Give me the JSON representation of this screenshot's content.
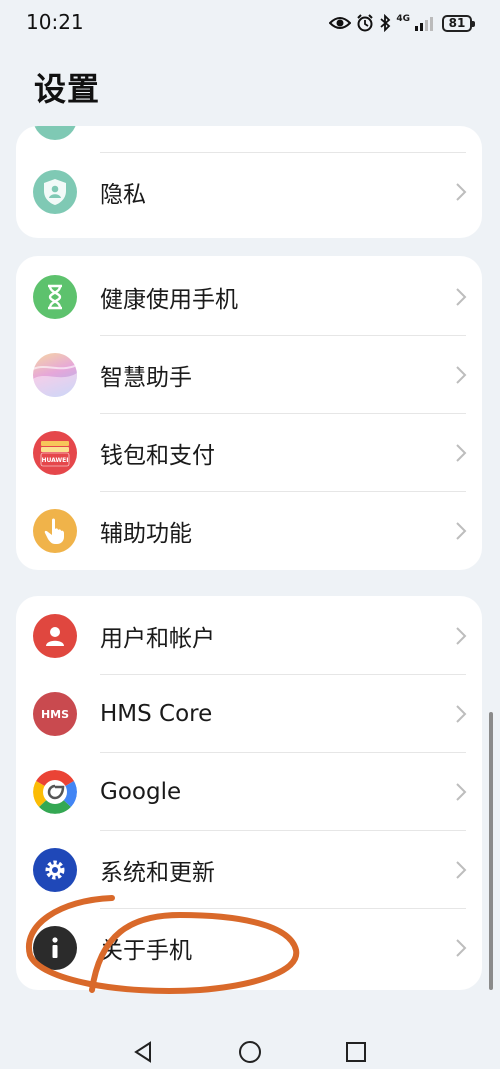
{
  "status_bar": {
    "time": "10:21",
    "network": "4G",
    "battery": "81",
    "icons": [
      "eye-comfort-icon",
      "alarm-icon",
      "bluetooth-icon",
      "signal-icon",
      "battery-icon"
    ]
  },
  "page": {
    "title": "设置"
  },
  "groups": [
    {
      "items": [
        {
          "label": "隐私",
          "icon": "privacy-icon",
          "color": "#7fc9b4"
        }
      ]
    },
    {
      "items": [
        {
          "label": "健康使用手机",
          "icon": "hourglass-icon",
          "color": "#5dc26d"
        },
        {
          "label": "智慧助手",
          "icon": "assistant-icon",
          "color": "#d7a7e6"
        },
        {
          "label": "钱包和支付",
          "icon": "wallet-icon",
          "color": "#e5474b",
          "brand": "HUAWEI"
        },
        {
          "label": "辅助功能",
          "icon": "hand-pointer-icon",
          "color": "#f0b34a"
        }
      ]
    },
    {
      "items": [
        {
          "label": "用户和帐户",
          "icon": "user-icon",
          "color": "#e0473f"
        },
        {
          "label": "HMS Core",
          "icon": "hms-icon",
          "color": "#c94a4f",
          "badge": "HMS"
        },
        {
          "label": "Google",
          "icon": "google-icon",
          "color": "#ffffff"
        },
        {
          "label": "系统和更新",
          "icon": "gear-icon",
          "color": "#1f48b8"
        },
        {
          "label": "关于手机",
          "icon": "info-icon",
          "color": "#2b2b2b"
        }
      ]
    }
  ],
  "annotation": {
    "color": "#d9692a"
  },
  "navigation": {
    "buttons": [
      "back-icon",
      "home-icon",
      "recents-icon"
    ]
  }
}
